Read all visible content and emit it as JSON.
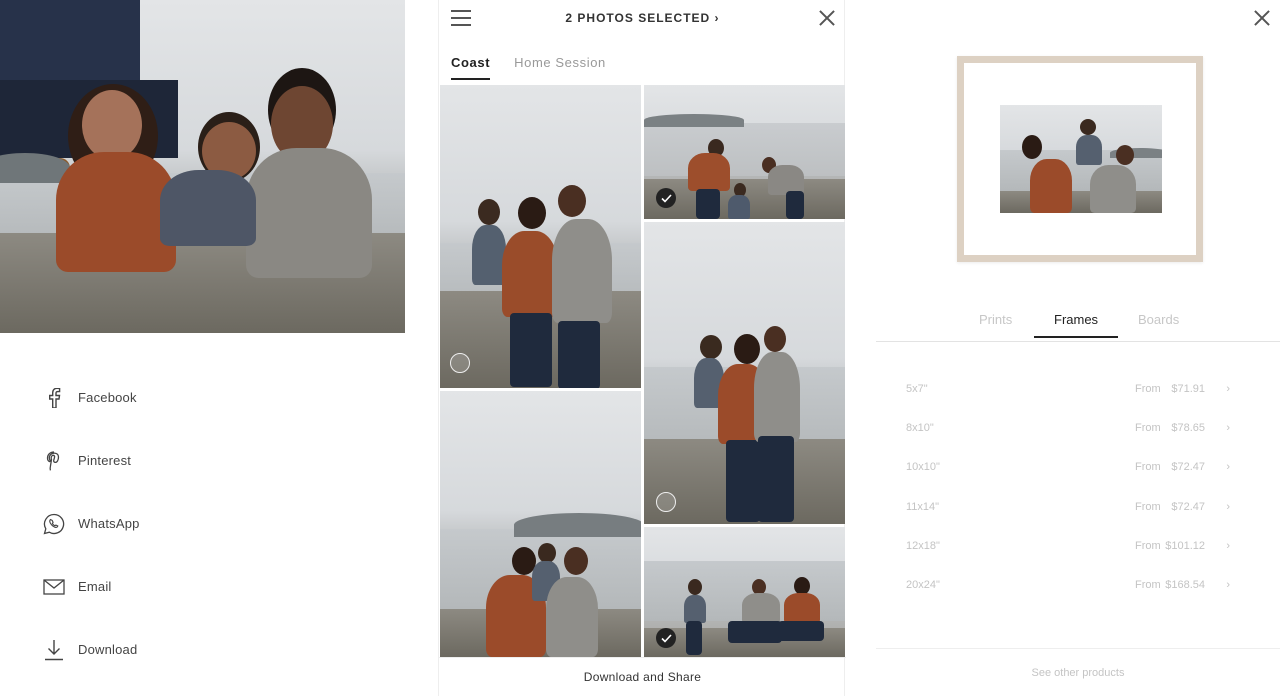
{
  "share": {
    "items": [
      {
        "label": "Facebook",
        "icon": "facebook-icon"
      },
      {
        "label": "Pinterest",
        "icon": "pinterest-icon"
      },
      {
        "label": "WhatsApp",
        "icon": "whatsapp-icon"
      },
      {
        "label": "Email",
        "icon": "email-icon"
      },
      {
        "label": "Download",
        "icon": "download-icon"
      }
    ]
  },
  "gallery": {
    "selected_title": "2 PHOTOS SELECTED ›",
    "tabs": [
      {
        "label": "Coast",
        "active": true
      },
      {
        "label": "Home Session",
        "active": false
      }
    ],
    "tiles": [
      {
        "selected": false
      },
      {
        "selected": true
      },
      {
        "selected": false
      },
      {
        "selected": false
      },
      {
        "selected": true
      }
    ],
    "footer_label": "Download and Share"
  },
  "product": {
    "tabs": [
      {
        "label": "Prints",
        "active": false
      },
      {
        "label": "Frames",
        "active": true
      },
      {
        "label": "Boards",
        "active": false
      }
    ],
    "from_label": "From",
    "sizes": [
      {
        "size": "5x7\"",
        "price": "$71.91"
      },
      {
        "size": "8x10\"",
        "price": "$78.65"
      },
      {
        "size": "10x10\"",
        "price": "$72.47"
      },
      {
        "size": "11x14\"",
        "price": "$72.47"
      },
      {
        "size": "12x18\"",
        "price": "$101.12"
      },
      {
        "size": "20x24\"",
        "price": "$168.54"
      }
    ],
    "footer_label": "See other products",
    "frame_color": "#ddd1c3"
  },
  "colors": {
    "text": "#333333",
    "muted": "#c4c4c4",
    "accent": "#222222"
  }
}
